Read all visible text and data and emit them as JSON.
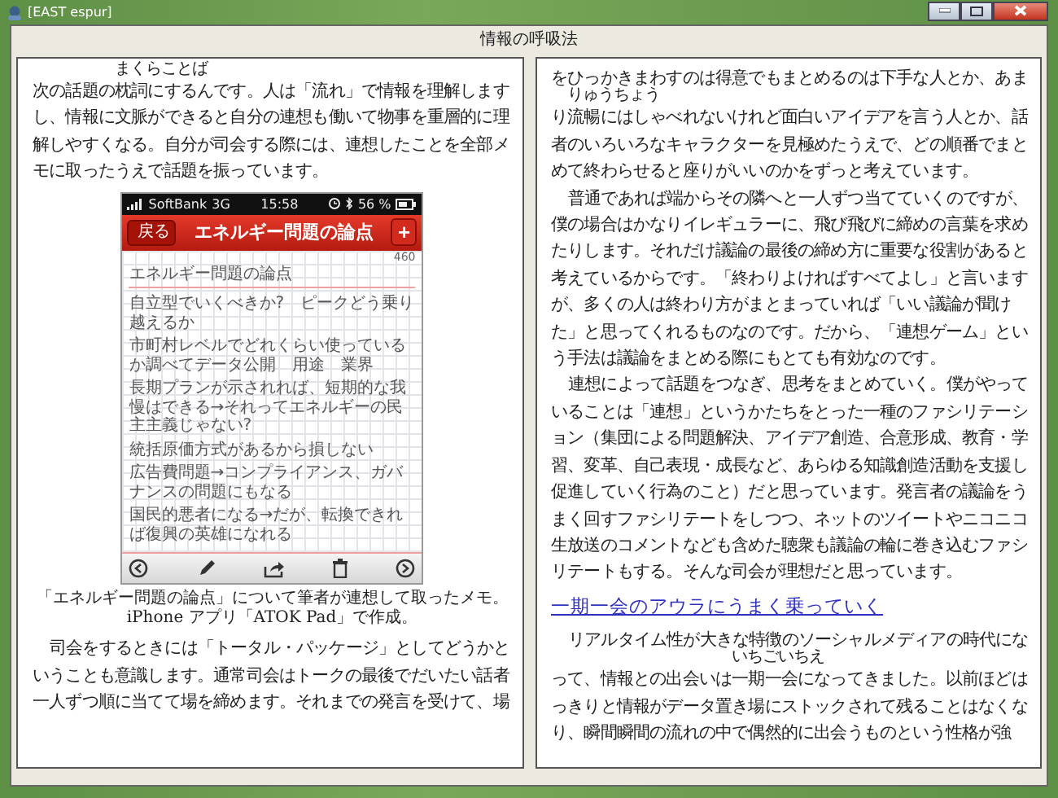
{
  "window": {
    "title": "[EAST espur]"
  },
  "book_title": "情報の呼吸法",
  "pages": [
    {
      "blocks": [
        {
          "kind": "paragraph",
          "indent": false,
          "segments": [
            {
              "text": "次の話題の"
            },
            {
              "text": "枕詞",
              "ruby": "まくらことば"
            },
            {
              "text": "にするんです。人は「流れ」で情報を理解しますし、情報に文脈ができると自分の連想も働いて物事を重層的に理解しやすくなる。自分が司会する際には、連想したことを全部メモに取ったうえで話題を振っています。"
            }
          ]
        },
        {
          "kind": "figure",
          "phone": {
            "carrier": "SoftBank",
            "network": "3G",
            "time": "15:58",
            "battery": "56 %",
            "back": "戻る",
            "title": "エネルギー問題の論点",
            "add": "+",
            "count": "460",
            "heading": "エネルギー問題の論点",
            "notes": [
              "自立型でいくべきか?　ピークどう乗り越えるか",
              "市町村レベルでどれくらい使っているか調べてデータ公開　用途　業界",
              "長期プランが示されれば、短期的な我慢はできる→それってエネルギーの民主主義じゃない?",
              "統括原価方式があるから損しない",
              "広告費問題→コンプライアンス、ガバナンスの問題にもなる",
              "国民的悪者になる→だが、転換できれば復興の英雄になれる"
            ]
          },
          "caption": "「エネルギー問題の論点」について筆者が連想して取ったメモ。iPhone アプリ「ATOK Pad」で作成。"
        },
        {
          "kind": "paragraph",
          "indent": true,
          "segments": [
            {
              "text": "司会をするときには「トータル・パッケージ」としてどうかということも意識します。通常司会はトークの最後でだいたい話者一人ずつ順に当てて場を締めます。それまでの発言を受けて、場"
            }
          ]
        }
      ]
    },
    {
      "blocks": [
        {
          "kind": "paragraph",
          "indent": false,
          "segments": [
            {
              "text": "をひっかきまわすのは得意でもまとめるのは下手な人とか、あまり"
            },
            {
              "text": "流暢",
              "ruby": "りゅうちょう"
            },
            {
              "text": "にはしゃべれないけれど面白いアイデアを言う人とか、話者のいろいろなキャラクターを見極めたうえで、どの順番でまとめて終わらせると座りがいいのかをずっと考えています。"
            }
          ]
        },
        {
          "kind": "paragraph",
          "indent": true,
          "segments": [
            {
              "text": "普通であれば端からその隣へと一人ずつ当てていくのですが、僕の場合はかなりイレギュラーに、飛び飛びに締めの言葉を求めたりします。それだけ議論の最後の締め方に重要な役割があると考えているからです。「終わりよければすべてよし」と言いますが、多くの人は終わり方がまとまっていれば「いい議論が聞けた」と思ってくれるものなのです。だから、「連想ゲーム」という手法は議論をまとめる際にもとても有効なのです。"
            }
          ]
        },
        {
          "kind": "paragraph",
          "indent": true,
          "segments": [
            {
              "text": "連想によって話題をつなぎ、思考をまとめていく。僕がやっていることは「連想」というかたちをとった一種のファシリテーション（集団による問題解決、アイデア創造、合意形成、教育・学習、変革、自己表現・成長など、あらゆる知識創造活動を支援し促進していく行為のこと）だと思っています。発言者の議論をうまく回すファシリテートをしつつ、ネットのツイートやニコニコ生放送のコメントなども含めた聴衆も議論の輪に巻き込むファシリテートもする。そんな司会が理想だと思っています。"
            }
          ]
        },
        {
          "kind": "heading",
          "text": "一期一会のアウラにうまく乗っていく"
        },
        {
          "kind": "paragraph",
          "indent": true,
          "segments": [
            {
              "text": "リアルタイム性が大きな特徴のソーシャルメディアの時代になって、情報との出会いは"
            },
            {
              "text": "一期一会",
              "ruby": "いちごいちえ"
            },
            {
              "text": "になってきました。以前ほどはっきりと情報がデータ置き場にストックされて残ることはなくなり、瞬間瞬間の流れの中で偶然的に出会うものという性格が強"
            }
          ]
        }
      ]
    }
  ]
}
